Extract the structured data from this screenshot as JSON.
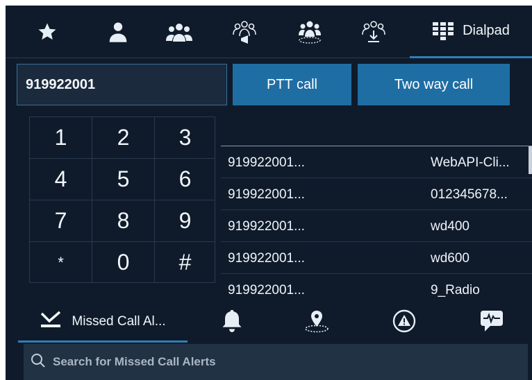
{
  "top_tabs": {
    "favorites_icon": "star-icon",
    "contact_icon": "person-icon",
    "groups_icon": "group-icon",
    "broadcast_icon": "group-broadcast-icon",
    "geofence_icon": "group-location-icon",
    "download_icon": "group-download-icon",
    "dialpad_icon": "keypad-grid-icon",
    "dialpad_label": "Dialpad"
  },
  "dialer": {
    "number_value": "919922001",
    "ptt_label": "PTT call",
    "two_way_label": "Two way call"
  },
  "keypad": {
    "keys": [
      "1",
      "2",
      "3",
      "4",
      "5",
      "6",
      "7",
      "8",
      "9",
      "*",
      "0",
      "#"
    ]
  },
  "recent_calls": [
    {
      "number": "919922001...",
      "name": "WebAPI-Cli..."
    },
    {
      "number": "919922001...",
      "name": "012345678..."
    },
    {
      "number": "919922001...",
      "name": "wd400"
    },
    {
      "number": "919922001...",
      "name": "wd600"
    },
    {
      "number": "919922001...",
      "name": "9_Radio"
    }
  ],
  "bottom_tabs": {
    "missed_icon": "missed-call-icon",
    "missed_label": "Missed Call Al...",
    "bell_icon": "bell-icon",
    "location_icon": "location-pin-icon",
    "warning_icon": "warning-icon",
    "voice_icon": "voice-message-icon"
  },
  "search": {
    "placeholder": "Search for Missed Call Alerts",
    "icon": "search-icon"
  },
  "colors": {
    "background": "#0f1b2b",
    "accent": "#1f6ea3",
    "active_underline": "#2f7fb7"
  }
}
